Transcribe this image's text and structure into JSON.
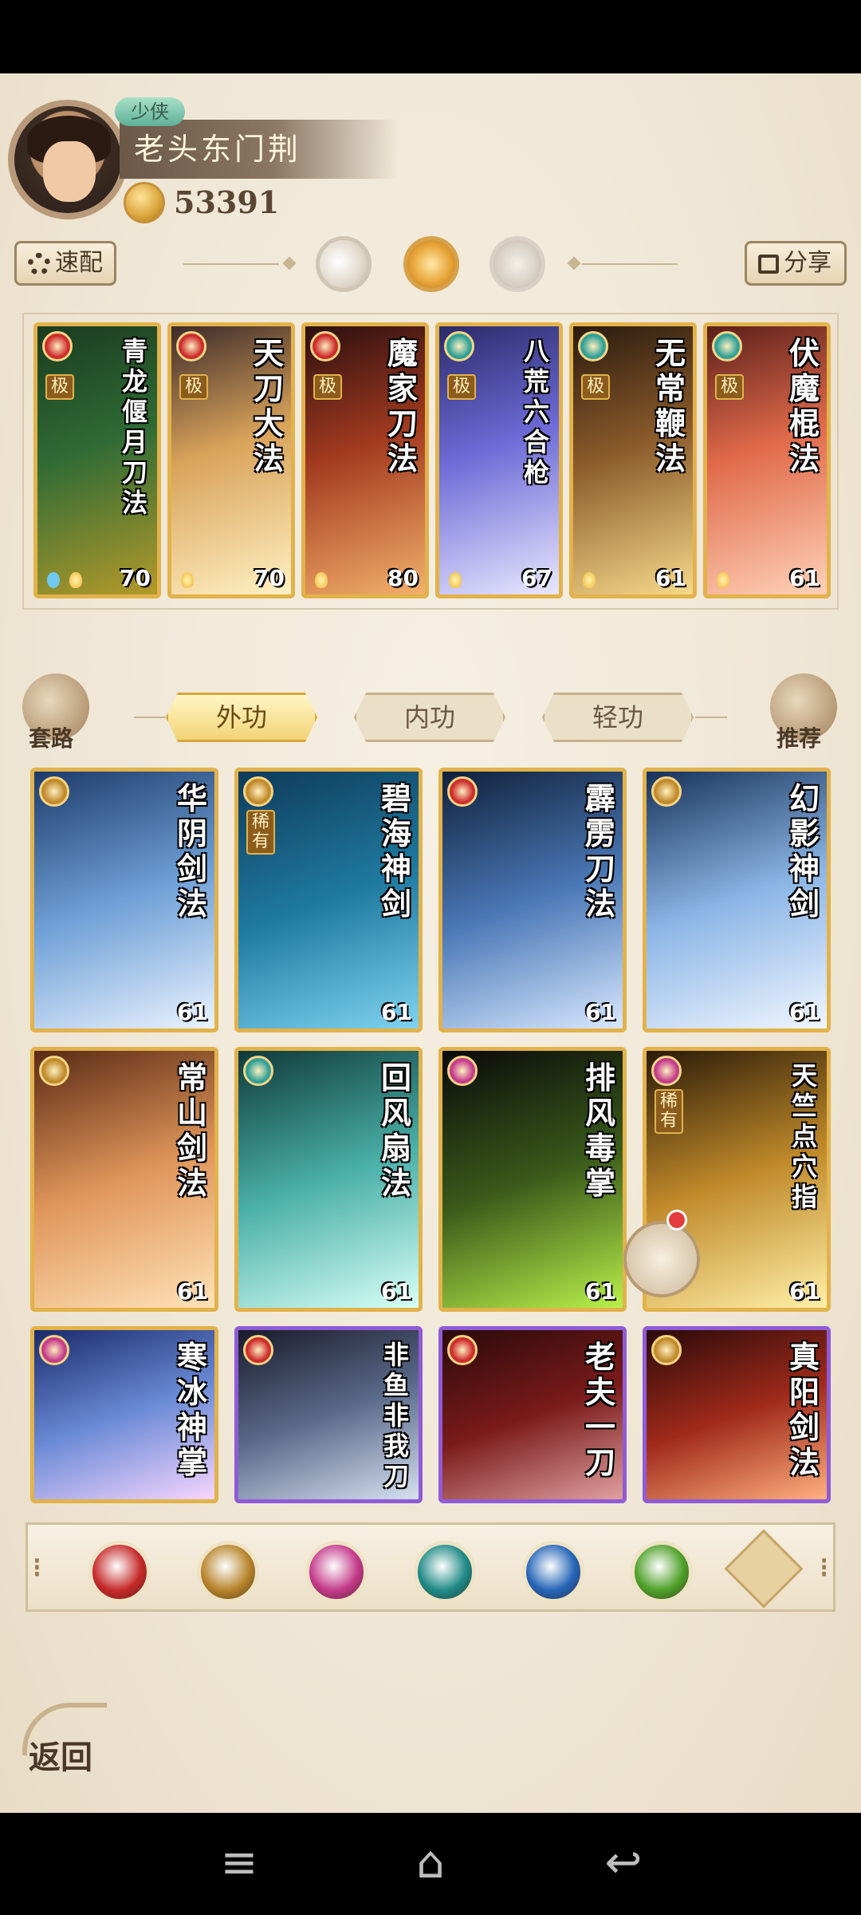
{
  "player": {
    "rank": "少侠",
    "name": "老头东门荆",
    "coins": "53391"
  },
  "top_buttons": {
    "quick_config": "速配",
    "share": "分享"
  },
  "lineup": [
    {
      "title": "青龙偃月刀法",
      "level": "70",
      "tag": "极",
      "icon": "blade-icon",
      "color": "#cc2b2b"
    },
    {
      "title": "天刀大法",
      "level": "70",
      "tag": "极",
      "icon": "blade-icon",
      "color": "#cc2b2b"
    },
    {
      "title": "魔家刀法",
      "level": "80",
      "tag": "极",
      "icon": "blade-icon",
      "color": "#cc2b2b"
    },
    {
      "title": "八荒六合枪",
      "level": "67",
      "tag": "极",
      "icon": "fan-icon",
      "color": "#2f9f96"
    },
    {
      "title": "无常鞭法",
      "level": "61",
      "tag": "极",
      "icon": "fan-icon",
      "color": "#2f9f96"
    },
    {
      "title": "伏魔棍法",
      "level": "61",
      "tag": "极",
      "icon": "fan-icon",
      "color": "#2f9f96"
    }
  ],
  "side": {
    "left_label": "套路",
    "right_label": "推荐"
  },
  "tabs": [
    {
      "label": "外功",
      "active": true
    },
    {
      "label": "内功",
      "active": false
    },
    {
      "label": "轻功",
      "active": false
    }
  ],
  "skills": [
    {
      "title": "华阴剑法",
      "level": "61",
      "tag": "",
      "icon": "sword-icon",
      "color": "#c08a2c"
    },
    {
      "title": "碧海神剑",
      "level": "61",
      "tag": "稀有",
      "icon": "sword-icon",
      "color": "#c08a2c"
    },
    {
      "title": "霹雳刀法",
      "level": "61",
      "tag": "",
      "icon": "blade-icon",
      "color": "#cc2b2b"
    },
    {
      "title": "幻影神剑",
      "level": "61",
      "tag": "",
      "icon": "sword-icon",
      "color": "#c08a2c"
    },
    {
      "title": "常山剑法",
      "level": "61",
      "tag": "",
      "icon": "sword-icon",
      "color": "#c08a2c"
    },
    {
      "title": "回风扇法",
      "level": "61",
      "tag": "",
      "icon": "fan-icon",
      "color": "#2f9f96"
    },
    {
      "title": "排风毒掌",
      "level": "61",
      "tag": "",
      "icon": "palm-icon",
      "color": "#c43a8a"
    },
    {
      "title": "天竺点穴指",
      "level": "61",
      "tag": "稀有",
      "icon": "palm-icon",
      "color": "#c43a8a"
    },
    {
      "title": "寒冰神掌",
      "level": "",
      "tag": "",
      "icon": "palm-icon",
      "color": "#c43a8a"
    },
    {
      "title": "非鱼非我刀",
      "level": "",
      "tag": "",
      "icon": "blade-icon",
      "color": "#cc2b2b"
    },
    {
      "title": "老夫一刀",
      "level": "",
      "tag": "",
      "icon": "blade-icon",
      "color": "#cc2b2b"
    },
    {
      "title": "真阳剑法",
      "level": "",
      "tag": "",
      "icon": "sword-icon",
      "color": "#c08a2c"
    }
  ],
  "filters": [
    {
      "name": "blade-filter-icon",
      "color": "#c62a2a"
    },
    {
      "name": "sword-filter-icon",
      "color": "#b8842a"
    },
    {
      "name": "palm-filter-icon",
      "color": "#c43a8a"
    },
    {
      "name": "fan-filter-icon",
      "color": "#1f8a86"
    },
    {
      "name": "yinyang-filter-icon",
      "color": "#2565b8"
    },
    {
      "name": "poison-filter-icon",
      "color": "#4fa12a"
    }
  ],
  "return_label": "返回"
}
